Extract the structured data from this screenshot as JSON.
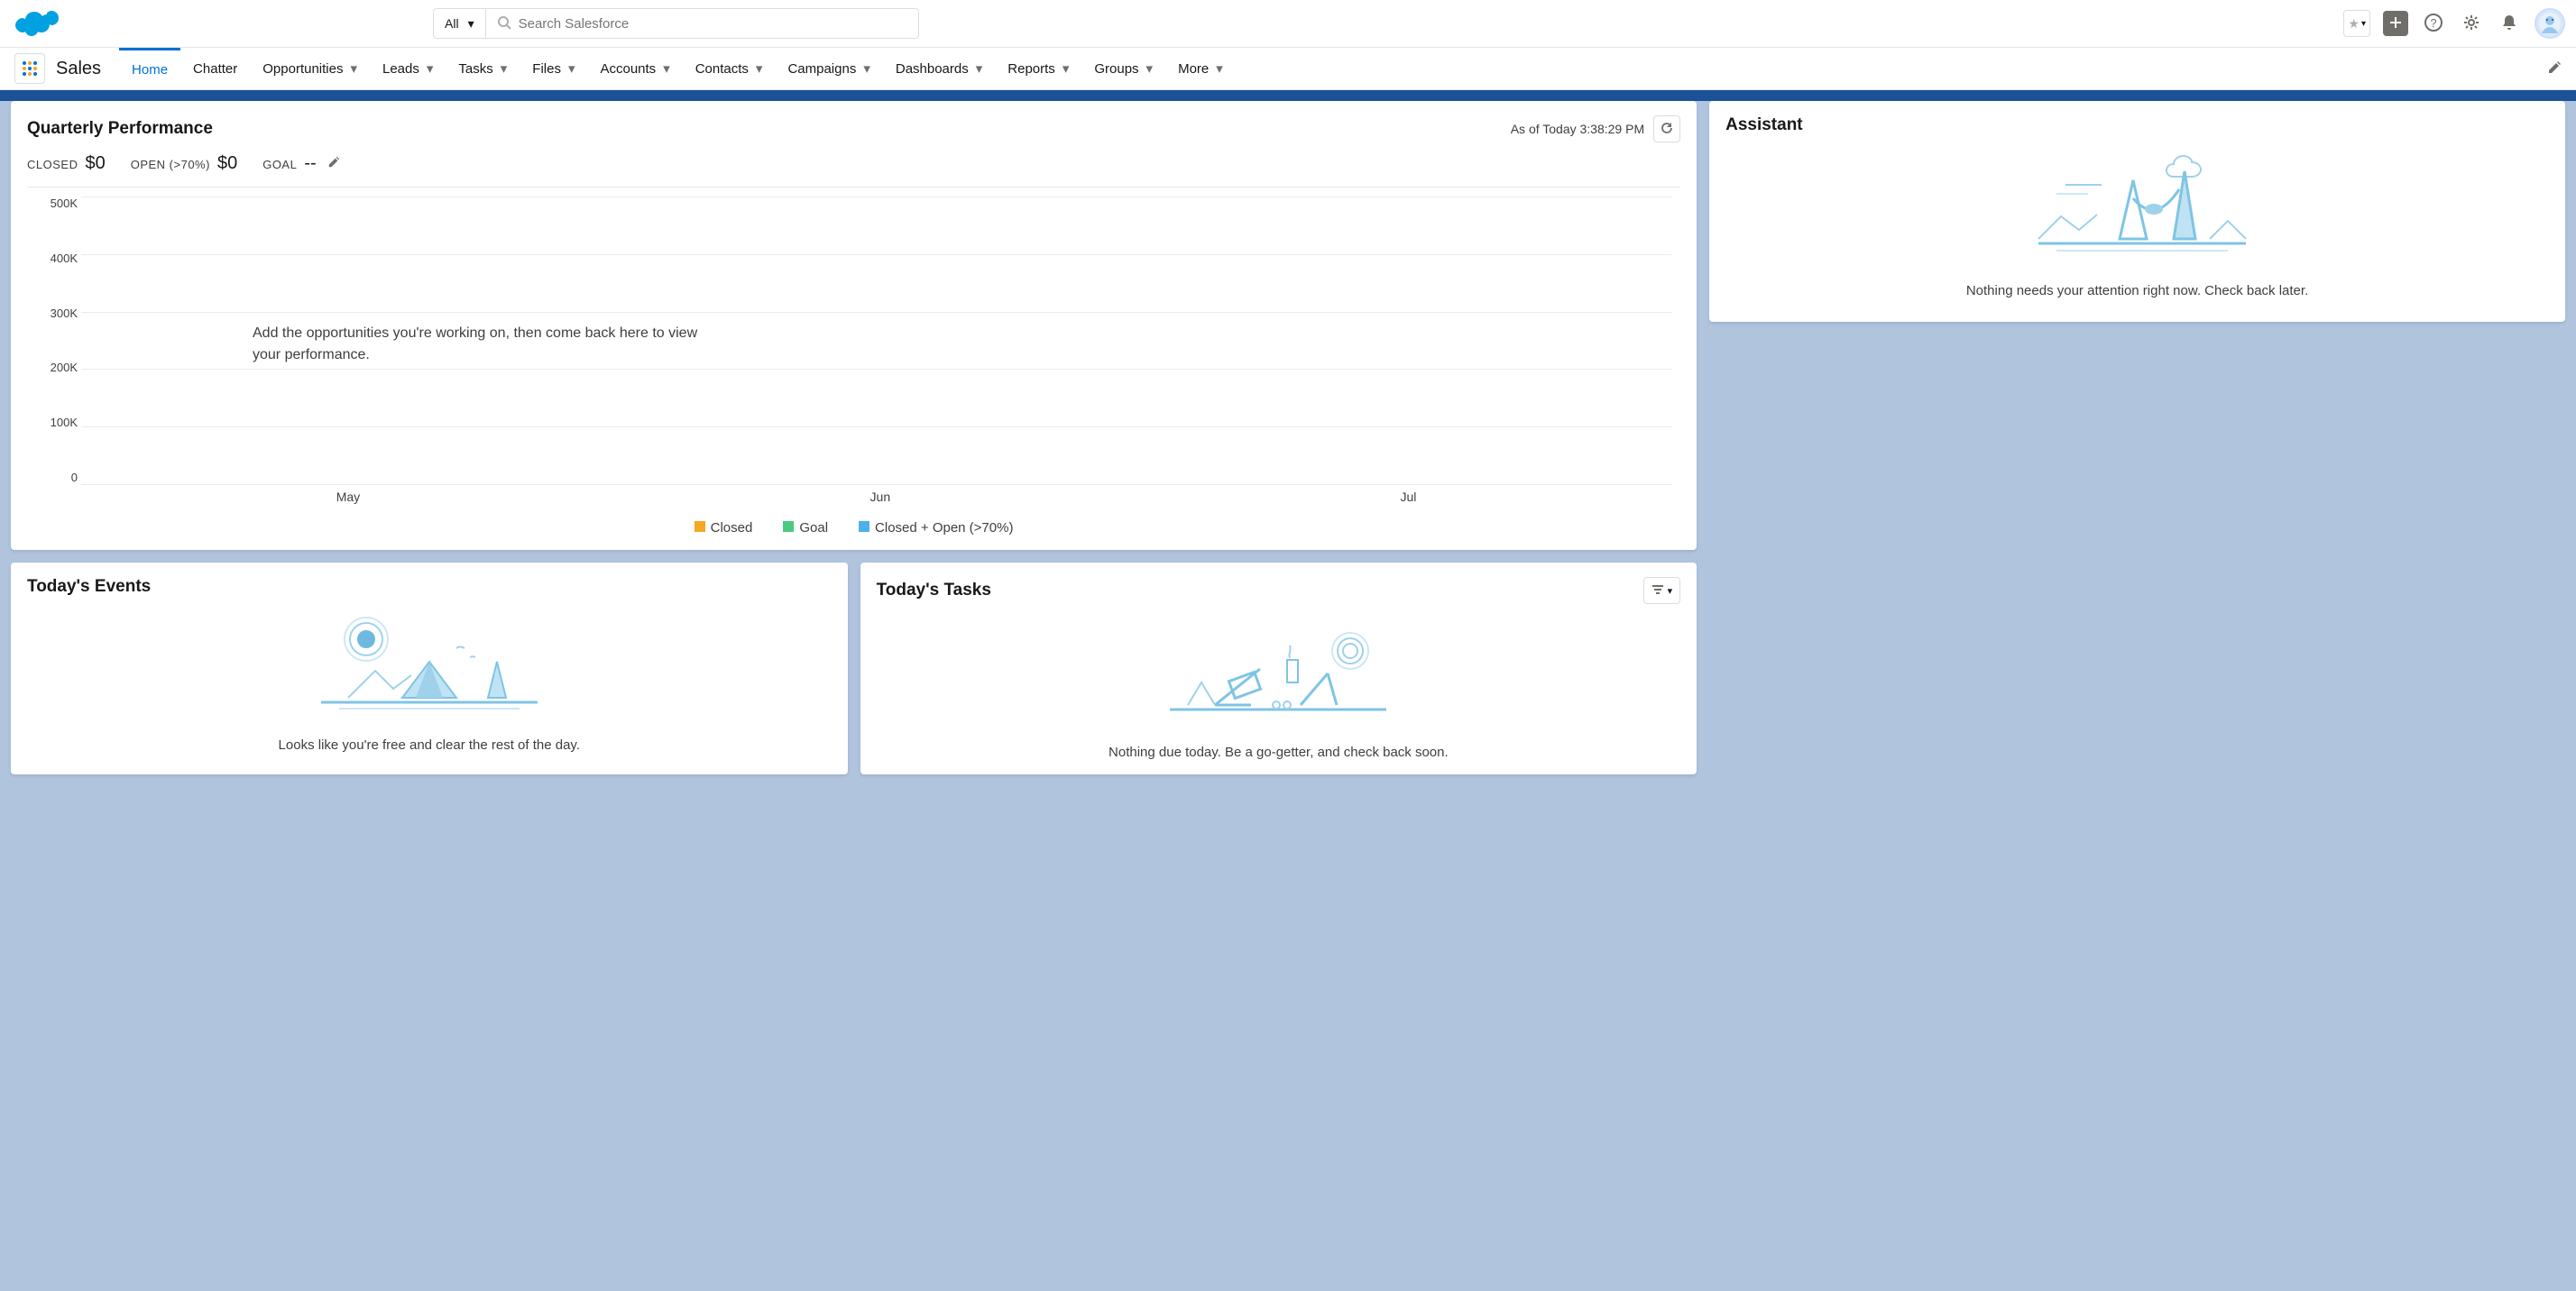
{
  "header": {
    "search_scope": "All",
    "search_placeholder": "Search Salesforce"
  },
  "nav": {
    "app_name": "Sales",
    "tabs": [
      "Home",
      "Chatter",
      "Opportunities",
      "Leads",
      "Tasks",
      "Files",
      "Accounts",
      "Contacts",
      "Campaigns",
      "Dashboards",
      "Reports",
      "Groups",
      "More"
    ],
    "active": "Home"
  },
  "quarterly": {
    "title": "Quarterly Performance",
    "as_of": "As of Today 3:38:29 PM",
    "closed_label": "CLOSED",
    "closed_value": "$0",
    "open_label": "OPEN (>70%)",
    "open_value": "$0",
    "goal_label": "GOAL",
    "goal_value": "--",
    "empty_msg": "Add the opportunities you're working on, then come back here to view your performance."
  },
  "events": {
    "title": "Today's Events",
    "empty": "Looks like you're free and clear the rest of the day."
  },
  "tasks": {
    "title": "Today's Tasks",
    "empty": "Nothing due today. Be a go-getter, and check back soon."
  },
  "assistant": {
    "title": "Assistant",
    "empty": "Nothing needs your attention right now. Check back later."
  },
  "chart_data": {
    "type": "line",
    "title": "Quarterly Performance",
    "x": [
      "May",
      "Jun",
      "Jul"
    ],
    "series": [
      {
        "name": "Closed",
        "values": [
          0,
          0,
          0
        ],
        "color": "#f5a623"
      },
      {
        "name": "Goal",
        "values": [
          0,
          0,
          0
        ],
        "color": "#4bca81"
      },
      {
        "name": "Closed + Open (>70%)",
        "values": [
          0,
          0,
          0
        ],
        "color": "#4cb1e8"
      }
    ],
    "y_ticks": [
      "500K",
      "400K",
      "300K",
      "200K",
      "100K",
      "0"
    ],
    "ylim": [
      0,
      500000
    ],
    "xlabel": "",
    "ylabel": ""
  }
}
